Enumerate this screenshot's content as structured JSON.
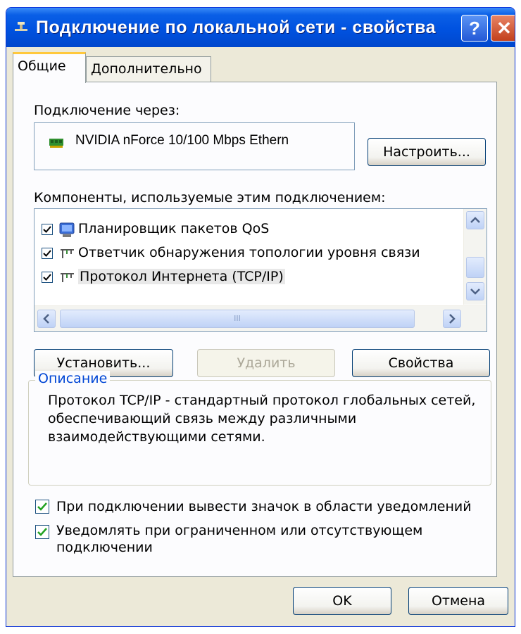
{
  "window": {
    "title": "Подключение по локальной сети - свойства",
    "help_label": "?",
    "close_label": "✕"
  },
  "tabs": [
    {
      "label": "Общие",
      "active": true
    },
    {
      "label": "Дополнительно",
      "active": false
    }
  ],
  "connect_via": {
    "label": "Подключение через:",
    "adapter": "NVIDIA nForce 10/100 Mbps Ethern",
    "configure_label": "Настроить..."
  },
  "components": {
    "label": "Компоненты, используемые этим подключением:",
    "items": [
      {
        "label": "Планировщик пакетов QoS",
        "checked": true,
        "icon": "qos-scheduler-icon"
      },
      {
        "label": "Ответчик обнаружения топологии уровня связи",
        "checked": true,
        "icon": "network-protocol-icon"
      },
      {
        "label": "Протокол Интернета (TCP/IP)",
        "checked": true,
        "icon": "network-protocol-icon",
        "selected": true
      }
    ],
    "scroll_grip": "III"
  },
  "buttons": {
    "install": "Установить...",
    "remove": "Удалить",
    "properties": "Свойства",
    "ok": "OK",
    "cancel": "Отмена"
  },
  "description": {
    "title": "Описание",
    "text": "Протокол TCP/IP - стандартный протокол глобальных сетей, обеспечивающий связь между различными взаимодействующими сетями."
  },
  "options": [
    {
      "label": "При подключении вывести значок в области уведомлений",
      "checked": true
    },
    {
      "label": "Уведомлять при ограниченном или отсутствующем подключении",
      "checked": true
    }
  ],
  "colors": {
    "titlebar": "#0052e0",
    "dialog_bg": "#ece9d8",
    "checkmark": "#21a121",
    "groupbox_title": "#0046d5"
  }
}
